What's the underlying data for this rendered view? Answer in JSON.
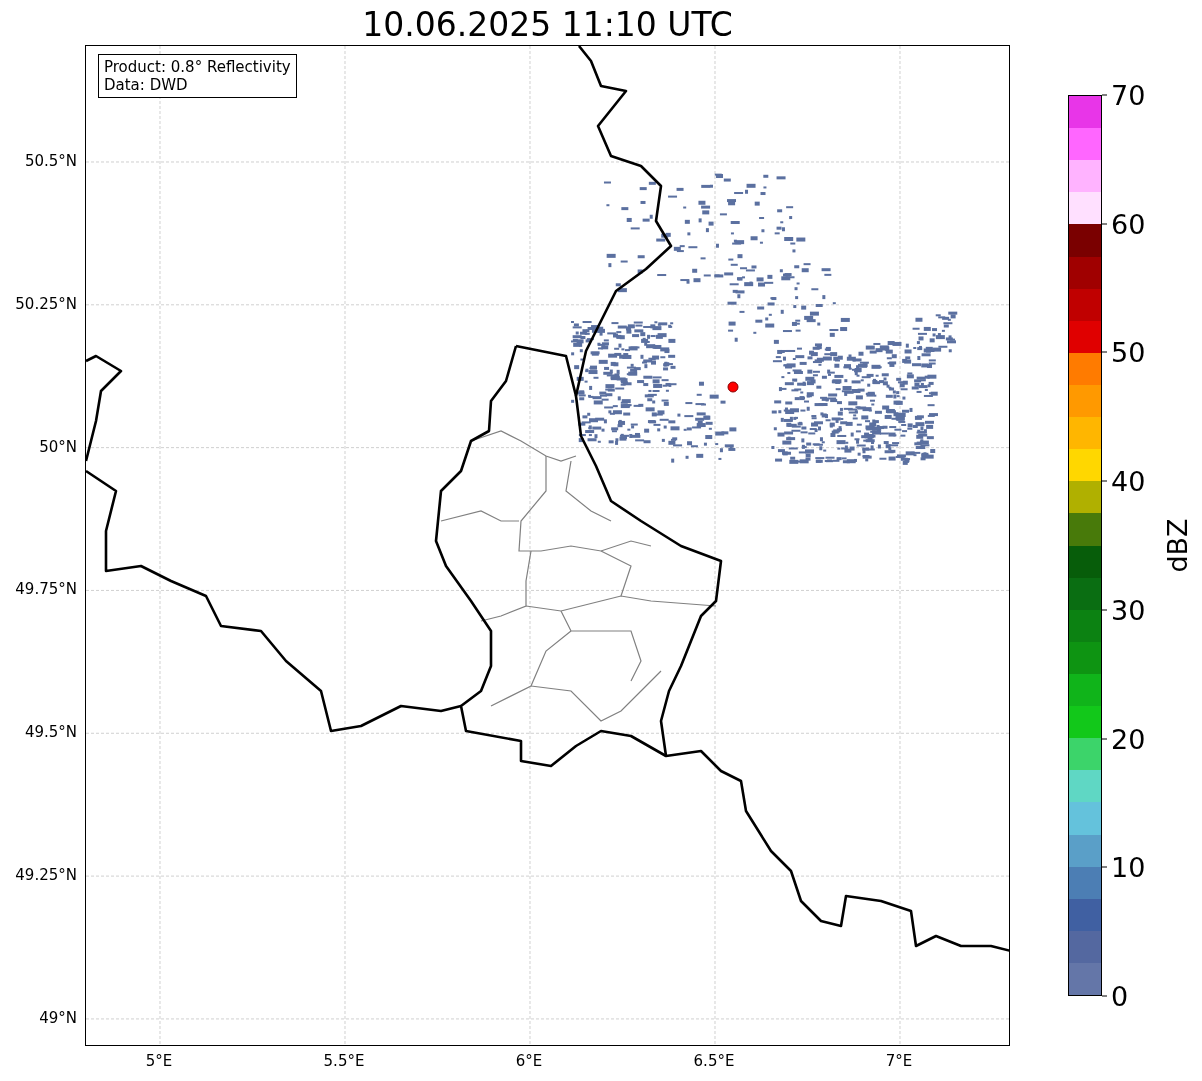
{
  "title": "10.06.2025 11:10 UTC",
  "info_box": [
    "Product: 0.8° Reflectivity",
    "Data: DWD"
  ],
  "x_ticks": [
    "5°E",
    "5.5°E",
    "6°E",
    "6.5°E",
    "7°E"
  ],
  "y_ticks": [
    "50.5°N",
    "50.25°N",
    "50°N",
    "49.75°N",
    "49.5°N",
    "49.25°N",
    "49°N"
  ],
  "colorbar": {
    "label": "dBZ",
    "ticks": [
      "70",
      "60",
      "50",
      "40",
      "30",
      "20",
      "10",
      "0"
    ],
    "bands": [
      {
        "color": "#e835e8"
      },
      {
        "color": "#ff66ff"
      },
      {
        "color": "#ffb3ff"
      },
      {
        "color": "#ffe0ff"
      },
      {
        "color": "#7a0000"
      },
      {
        "color": "#a00000"
      },
      {
        "color": "#c00000"
      },
      {
        "color": "#e00000"
      },
      {
        "color": "#ff7b00"
      },
      {
        "color": "#ff9900"
      },
      {
        "color": "#ffb600"
      },
      {
        "color": "#ffd700"
      },
      {
        "color": "#b0b000"
      },
      {
        "color": "#487a0a"
      },
      {
        "color": "#075d0a"
      },
      {
        "color": "#0a6e12"
      },
      {
        "color": "#0c8212"
      },
      {
        "color": "#0e9412"
      },
      {
        "color": "#10b41a"
      },
      {
        "color": "#12c81a"
      },
      {
        "color": "#3cd46a"
      },
      {
        "color": "#5fd7c4"
      },
      {
        "color": "#64c2dc"
      },
      {
        "color": "#5a9fc8"
      },
      {
        "color": "#4c7eb4"
      },
      {
        "color": "#4060a2"
      },
      {
        "color": "#5468a0"
      },
      {
        "color": "#6476a8"
      }
    ]
  }
}
